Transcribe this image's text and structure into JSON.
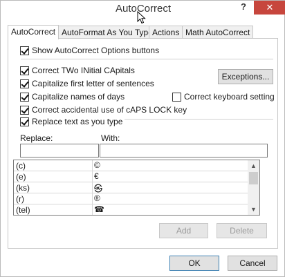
{
  "dialog": {
    "title": "AutoCorrect",
    "help": "?",
    "close": "✕"
  },
  "tabs": [
    {
      "label": "AutoCorrect"
    },
    {
      "label": "AutoFormat As You Type"
    },
    {
      "label": "Actions"
    },
    {
      "label": "Math AutoCorrect"
    }
  ],
  "options": {
    "show_buttons": "Show AutoCorrect Options buttons",
    "two_initial_caps": "Correct TWo INitial CApitals",
    "first_letter": "Capitalize first letter of sentences",
    "names_of_days": "Capitalize names of days",
    "caps_lock": "Correct accidental use of cAPS LOCK key",
    "keyboard_setting": "Correct keyboard setting",
    "replace_text": "Replace text as you type",
    "exceptions_button": "Exceptions..."
  },
  "replace_section": {
    "replace_label": "Replace:",
    "with_label": "With:",
    "replace_value": "",
    "with_value": ""
  },
  "entries": [
    {
      "replace": "(c)",
      "with": "©"
    },
    {
      "replace": "(e)",
      "with": "€"
    },
    {
      "replace": "(ks)",
      "with": "㉿"
    },
    {
      "replace": "(r)",
      "with": "®"
    },
    {
      "replace": "(tel)",
      "with": "☎"
    }
  ],
  "actions": {
    "add": "Add",
    "delete": "Delete",
    "ok": "OK",
    "cancel": "Cancel"
  },
  "colors": {
    "close_red": "#c7463d",
    "ok_border": "#3c7fb1"
  }
}
